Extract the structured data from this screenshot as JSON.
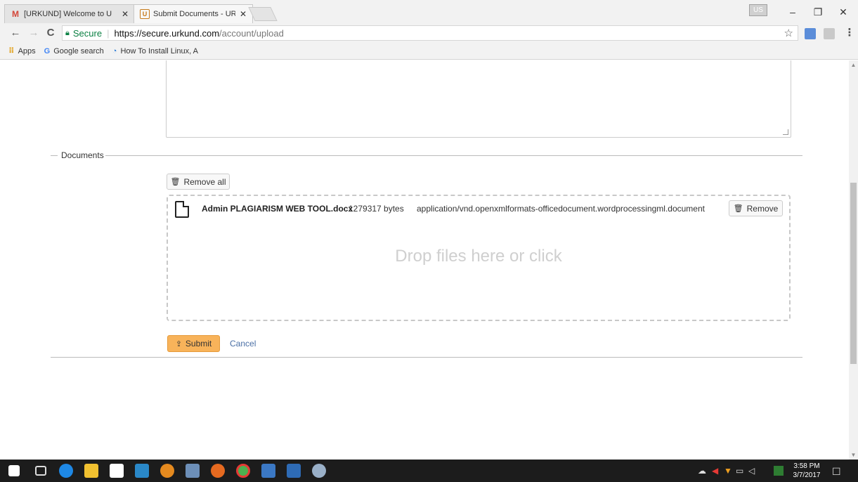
{
  "browser": {
    "tabs": [
      {
        "title": "[URKUND] Welcome to U",
        "favicon": "gmail-icon",
        "active": false
      },
      {
        "title": "Submit Documents - UR",
        "favicon": "urkund-icon",
        "active": true
      }
    ],
    "user_chip": "US",
    "address": {
      "secure_label": "Secure",
      "url_host": "https://secure.urkund.com",
      "url_path": "/account/upload"
    },
    "bookmarks": [
      {
        "label": "Apps",
        "icon": "apps-grid-icon"
      },
      {
        "label": "Google search",
        "icon": "google-icon"
      },
      {
        "label": "How To Install Linux, A",
        "icon": "linux-site-icon"
      }
    ]
  },
  "form": {
    "documents_legend": "Documents",
    "remove_all_label": "Remove all",
    "file": {
      "name": "Admin PLAGIARISM WEB TOOL.docx",
      "size": "1279317 bytes",
      "type": "application/vnd.openxmlformats-officedocument.wordprocessingml.document"
    },
    "remove_label": "Remove",
    "dropzone_text": "Drop files here or click",
    "submit_label": "Submit",
    "cancel_label": "Cancel"
  },
  "taskbar": {
    "time": "3:58 PM",
    "date": "3/7/2017"
  },
  "colors": {
    "submit_bg": "#f8b35a",
    "secure_green": "#0b8043",
    "link_blue": "#4a6fa5",
    "taskbar_bg": "#1c1c1c"
  }
}
